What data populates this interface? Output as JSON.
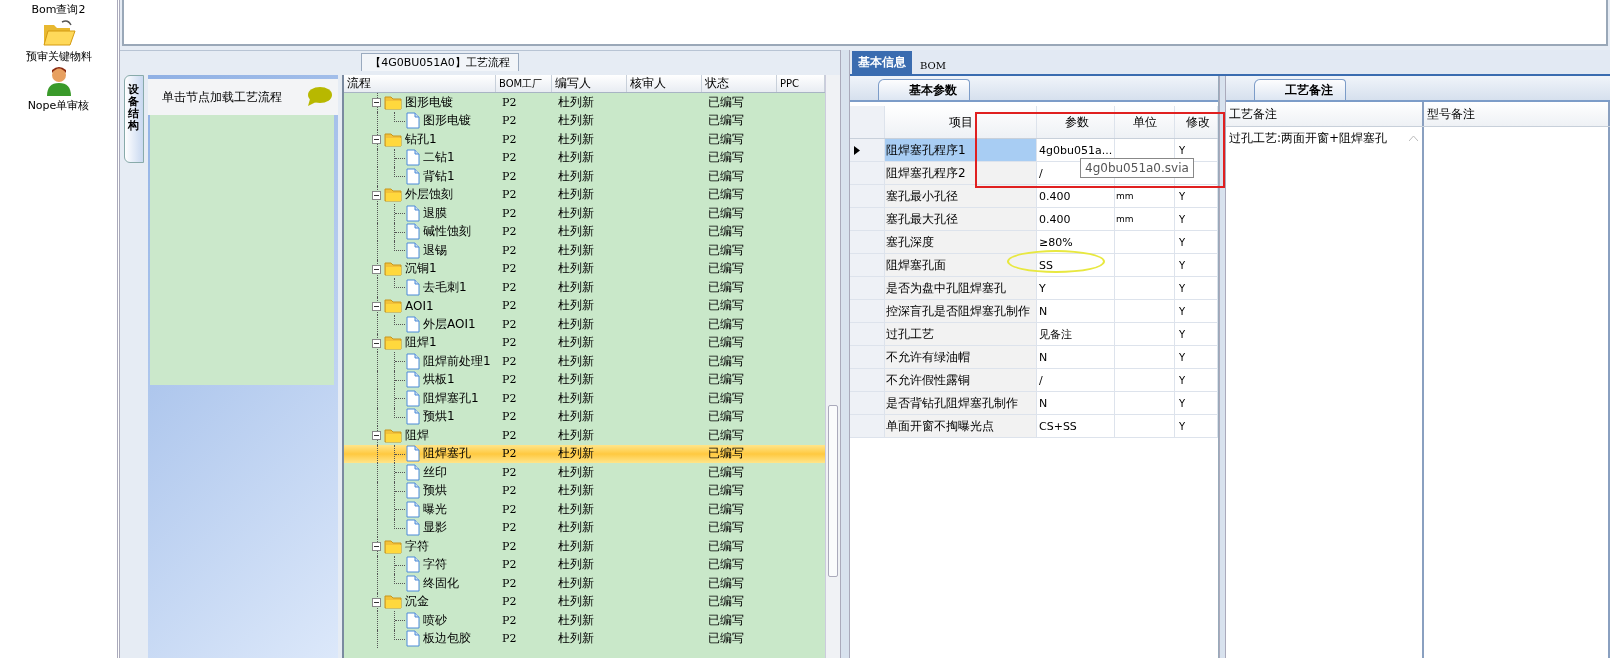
{
  "sidebar": {
    "items": [
      {
        "label": "Bom查询2",
        "kind": "text"
      },
      {
        "label": "预审关键物料",
        "kind": "folder"
      },
      {
        "label": "Nope单审核",
        "kind": "person"
      }
    ]
  },
  "flow_panel": {
    "title": "【4G0BU051A0】工艺流程",
    "side_tab": "设备结构",
    "hint": "单击节点加载工艺流程"
  },
  "tree": {
    "columns": [
      "流程",
      "BOM工厂",
      "编写人",
      "核审人",
      "状态",
      "PPC"
    ],
    "rows": [
      {
        "label": "图形电镀",
        "factory": "P2",
        "writer": "杜列新",
        "status": "已编写",
        "selected": false,
        "expanded": true,
        "children": [
          {
            "label": "图形电镀",
            "factory": "P2",
            "writer": "杜列新",
            "status": "已编写",
            "selected": false
          }
        ]
      },
      {
        "label": "钻孔1",
        "factory": "P2",
        "writer": "杜列新",
        "status": "已编写",
        "selected": false,
        "expanded": true,
        "children": [
          {
            "label": "二钻1",
            "factory": "P2",
            "writer": "杜列新",
            "status": "已编写",
            "selected": false
          },
          {
            "label": "背钻1",
            "factory": "P2",
            "writer": "杜列新",
            "status": "已编写",
            "selected": false
          }
        ]
      },
      {
        "label": "外层蚀刻",
        "factory": "P2",
        "writer": "杜列新",
        "status": "已编写",
        "selected": false,
        "expanded": true,
        "children": [
          {
            "label": "退膜",
            "factory": "P2",
            "writer": "杜列新",
            "status": "已编写",
            "selected": false
          },
          {
            "label": "碱性蚀刻",
            "factory": "P2",
            "writer": "杜列新",
            "status": "已编写",
            "selected": false
          },
          {
            "label": "退锡",
            "factory": "P2",
            "writer": "杜列新",
            "status": "已编写",
            "selected": false
          }
        ]
      },
      {
        "label": "沉铜1",
        "factory": "P2",
        "writer": "杜列新",
        "status": "已编写",
        "selected": false,
        "expanded": true,
        "children": [
          {
            "label": "去毛刺1",
            "factory": "P2",
            "writer": "杜列新",
            "status": "已编写",
            "selected": false
          }
        ]
      },
      {
        "label": "AOI1",
        "factory": "P2",
        "writer": "杜列新",
        "status": "已编写",
        "selected": false,
        "expanded": true,
        "children": [
          {
            "label": "外层AOI1",
            "factory": "P2",
            "writer": "杜列新",
            "status": "已编写",
            "selected": false
          }
        ]
      },
      {
        "label": "阻焊1",
        "factory": "P2",
        "writer": "杜列新",
        "status": "已编写",
        "selected": false,
        "expanded": true,
        "children": [
          {
            "label": "阻焊前处理1",
            "factory": "P2",
            "writer": "杜列新",
            "status": "已编写",
            "selected": false
          },
          {
            "label": "烘板1",
            "factory": "P2",
            "writer": "杜列新",
            "status": "已编写",
            "selected": false
          },
          {
            "label": "阻焊塞孔1",
            "factory": "P2",
            "writer": "杜列新",
            "status": "已编写",
            "selected": false
          },
          {
            "label": "预烘1",
            "factory": "P2",
            "writer": "杜列新",
            "status": "已编写",
            "selected": false
          }
        ]
      },
      {
        "label": "阻焊",
        "factory": "P2",
        "writer": "杜列新",
        "status": "已编写",
        "selected": false,
        "expanded": true,
        "children": [
          {
            "label": "阻焊塞孔",
            "factory": "P2",
            "writer": "杜列新",
            "status": "已编写",
            "selected": true
          },
          {
            "label": "丝印",
            "factory": "P2",
            "writer": "杜列新",
            "status": "已编写",
            "selected": false
          },
          {
            "label": "预烘",
            "factory": "P2",
            "writer": "杜列新",
            "status": "已编写",
            "selected": false
          },
          {
            "label": "曝光",
            "factory": "P2",
            "writer": "杜列新",
            "status": "已编写",
            "selected": false
          },
          {
            "label": "显影",
            "factory": "P2",
            "writer": "杜列新",
            "status": "已编写",
            "selected": false
          }
        ]
      },
      {
        "label": "字符",
        "factory": "P2",
        "writer": "杜列新",
        "status": "已编写",
        "selected": false,
        "expanded": true,
        "children": [
          {
            "label": "字符",
            "factory": "P2",
            "writer": "杜列新",
            "status": "已编写",
            "selected": false
          },
          {
            "label": "终固化",
            "factory": "P2",
            "writer": "杜列新",
            "status": "已编写",
            "selected": false
          }
        ]
      },
      {
        "label": "沉金",
        "factory": "P2",
        "writer": "杜列新",
        "status": "已编写",
        "selected": false,
        "expanded": true,
        "children": [
          {
            "label": "喷砂",
            "factory": "P2",
            "writer": "杜列新",
            "status": "已编写",
            "selected": false
          },
          {
            "label": "板边包胶",
            "factory": "P2",
            "writer": "杜列新",
            "status": "已编写",
            "selected": false
          }
        ]
      }
    ]
  },
  "detail": {
    "tabs": [
      {
        "label": "基本信息",
        "selected": true
      },
      {
        "label": "BOM",
        "selected": false
      }
    ],
    "params": {
      "tab": "基本参数",
      "columns": [
        "项目",
        "参数",
        "单位",
        "修改"
      ],
      "tooltip": "4g0bu051a0.svia",
      "rows": [
        {
          "item": "阻焊塞孔程序1",
          "value": "4g0bu051a...",
          "modify": "Y",
          "selected": true
        },
        {
          "item": "阻焊塞孔程序2",
          "value": "/",
          "selected": false
        },
        {
          "item": "塞孔最小孔径",
          "value": "0.400",
          "unit": "mm",
          "modify": "Y",
          "selected": false
        },
        {
          "item": "塞孔最大孔径",
          "value": "0.400",
          "unit": "mm",
          "modify": "Y",
          "selected": false
        },
        {
          "item": "塞孔深度",
          "value": "≥80%",
          "modify": "Y",
          "selected": false
        },
        {
          "item": "阻焊塞孔面",
          "value": "SS",
          "modify": "Y",
          "selected": false
        },
        {
          "item": "是否为盘中孔阻焊塞孔",
          "value": "Y",
          "modify": "Y",
          "selected": false
        },
        {
          "item": "控深盲孔是否阻焊塞孔制作",
          "value": "N",
          "modify": "Y",
          "selected": false
        },
        {
          "item": "过孔工艺",
          "value": "见备注",
          "modify": "Y",
          "selected": false
        },
        {
          "item": "不允许有绿油帽",
          "value": "N",
          "modify": "Y",
          "selected": false
        },
        {
          "item": "不允许假性露铜",
          "value": "/",
          "modify": "Y",
          "selected": false
        },
        {
          "item": "是否背钻孔阻焊塞孔制作",
          "value": "N",
          "modify": "Y",
          "selected": false
        },
        {
          "item": "单面开窗不掏曝光点",
          "value": "CS+SS",
          "modify": "Y",
          "selected": false
        }
      ]
    },
    "notes": {
      "tab": "工艺备注",
      "columns": [
        "工艺备注",
        "型号备注"
      ],
      "process_note": "过孔工艺:两面开窗+阻焊塞孔"
    }
  }
}
